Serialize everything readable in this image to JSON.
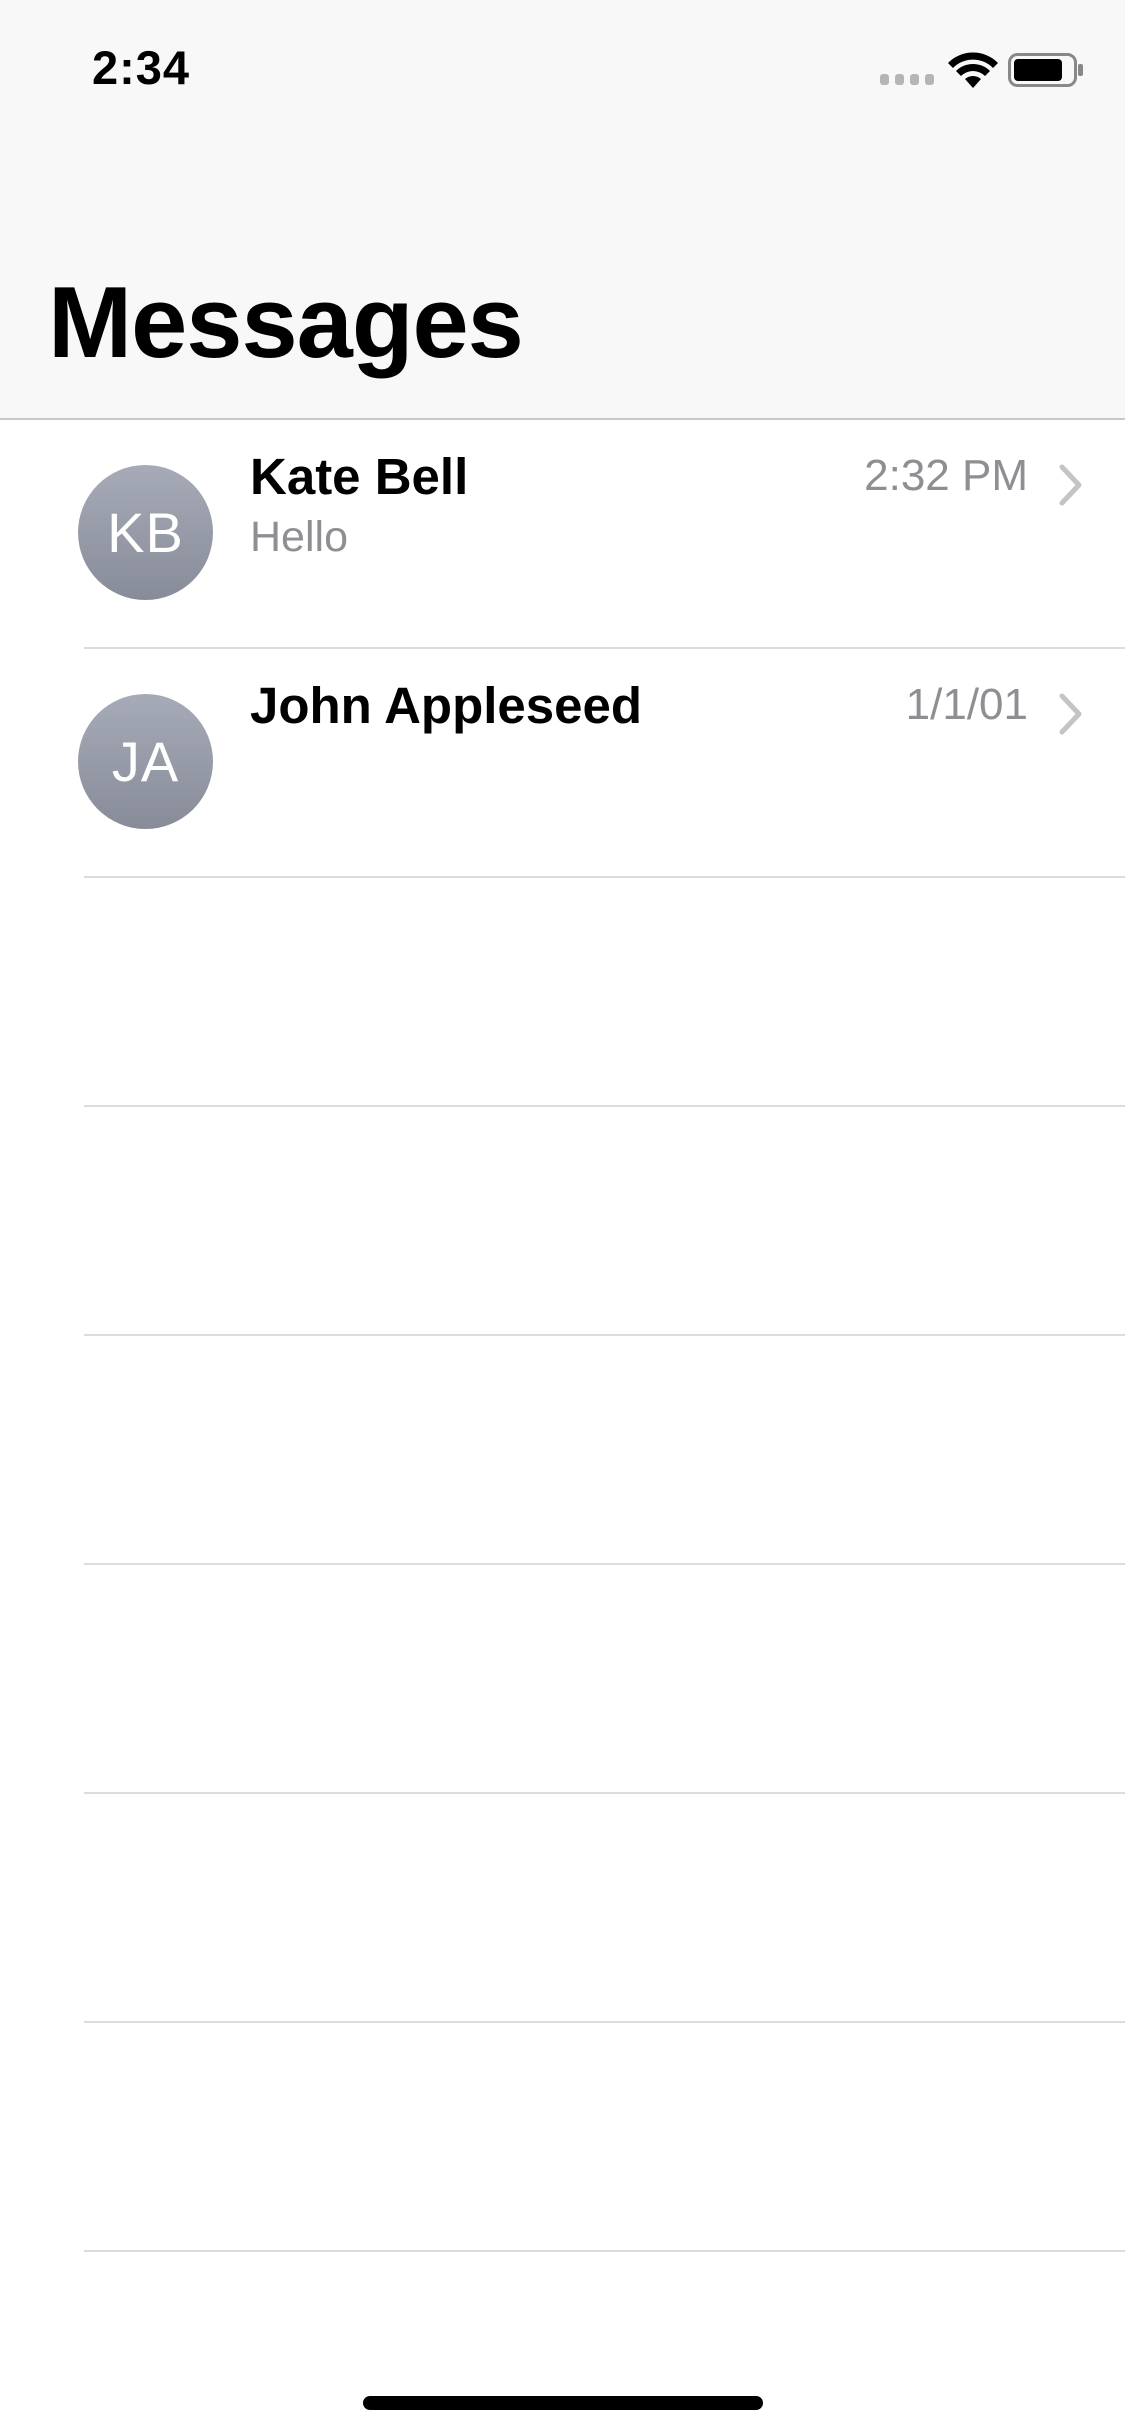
{
  "status_bar": {
    "time": "2:34",
    "icons": [
      "signal-icon",
      "wifi-icon",
      "battery-icon"
    ]
  },
  "header": {
    "title": "Messages"
  },
  "conversations": [
    {
      "initials": "KB",
      "name": "Kate Bell",
      "preview": "Hello",
      "time": "2:32 PM"
    },
    {
      "initials": "JA",
      "name": "John Appleseed",
      "preview": "",
      "time": "1/1/01"
    }
  ],
  "colors": {
    "header_bg": "#f8f8f8",
    "secondary_text": "#8e8e93",
    "avatar_top": "#a6abb7",
    "avatar_bottom": "#878c98",
    "separator": "#dcdcdf"
  }
}
